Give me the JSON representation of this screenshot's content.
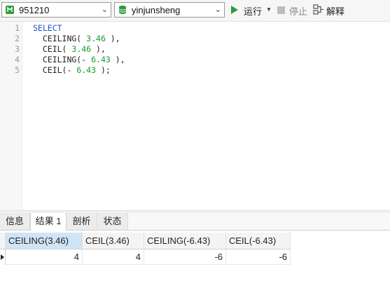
{
  "toolbar": {
    "connection": "951210",
    "database": "yinjunsheng",
    "run_label": "运行",
    "stop_label": "停止",
    "explain_label": "解释"
  },
  "editor": {
    "line_numbers": [
      "1",
      "2",
      "3",
      "4",
      "5"
    ]
  },
  "result_tabs": [
    "信息",
    "结果 1",
    "剖析",
    "状态"
  ],
  "result_grid": {
    "columns": [
      "CEILING(3.46)",
      "CEIL(3.46)",
      "CEILING(-6.43)",
      "CEIL(-6.43)"
    ],
    "rows": [
      [
        "4",
        "4",
        "-6",
        "-6"
      ]
    ]
  },
  "colors": {
    "keyword": "#1a56c9",
    "number": "#1a9a2f",
    "run": "#2e9b3d",
    "selected_header": "#cfe4f7"
  }
}
